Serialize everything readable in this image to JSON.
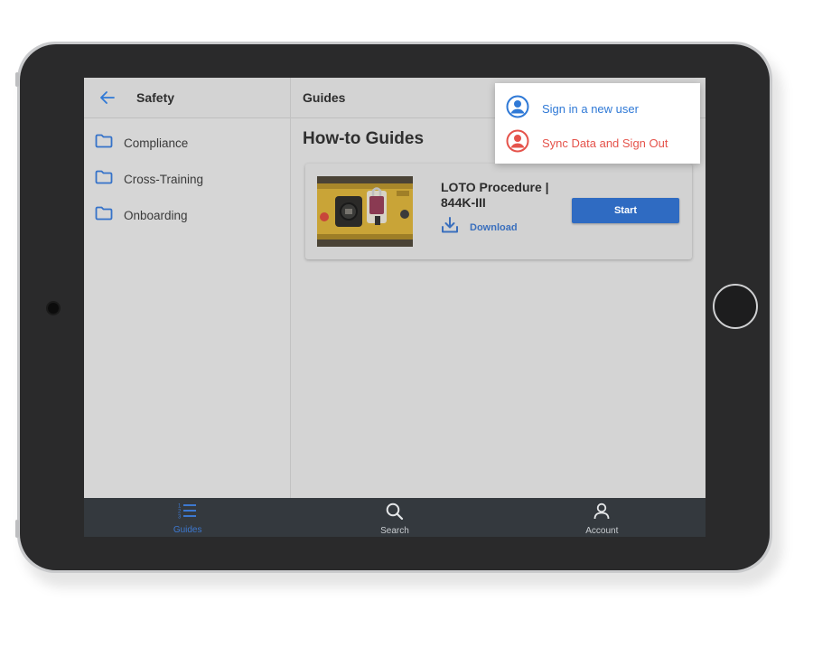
{
  "left_panel": {
    "title": "Safety",
    "folders": [
      {
        "label": "Compliance"
      },
      {
        "label": "Cross-Training"
      },
      {
        "label": "Onboarding"
      }
    ]
  },
  "right_panel": {
    "title": "Guides",
    "heading": "How-to Guides",
    "guide": {
      "title": "LOTO Procedure | 844K-III",
      "download_label": "Download",
      "start_label": "Start"
    }
  },
  "account_menu": {
    "items": [
      {
        "label": "Sign in a new user",
        "color": "#2f79d6",
        "icon": "user-circle-icon"
      },
      {
        "label": "Sync Data and Sign Out",
        "color": "#e5534b",
        "icon": "user-circle-icon"
      }
    ]
  },
  "tabbar": {
    "tabs": [
      {
        "label": "Guides",
        "icon": "numbered-list-icon",
        "active": true
      },
      {
        "label": "Search",
        "icon": "search-icon",
        "active": false
      },
      {
        "label": "Account",
        "icon": "person-icon",
        "active": false
      }
    ]
  },
  "colors": {
    "accent": "#2f6bc2",
    "active_tab": "#3d78cf",
    "danger": "#e5534b",
    "tabbar_bg": "#34393e"
  }
}
